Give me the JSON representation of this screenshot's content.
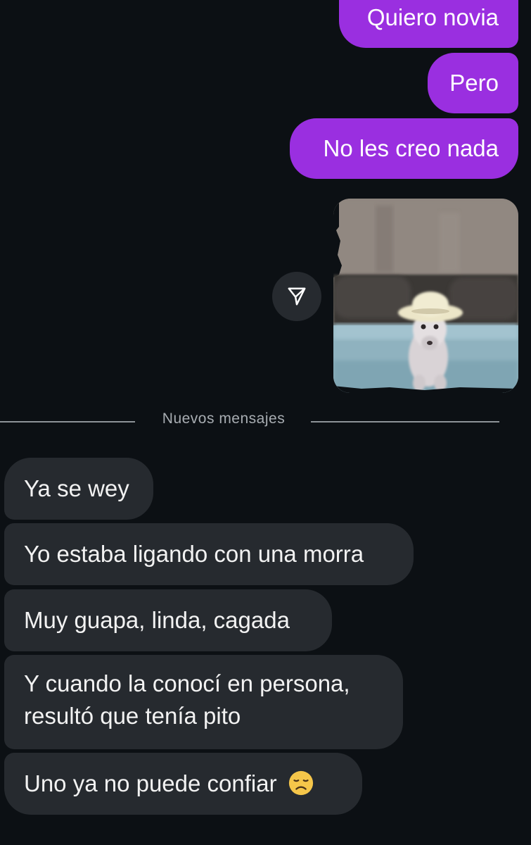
{
  "outgoing_messages": [
    {
      "text": "Quiero novia"
    },
    {
      "text": "Pero"
    },
    {
      "text": "No les creo nada"
    }
  ],
  "image_message": {
    "description_icon": "share-icon"
  },
  "divider": {
    "label": "Nuevos mensajes"
  },
  "incoming_messages": [
    {
      "text": "Ya se wey"
    },
    {
      "text": "Yo estaba ligando con una morra"
    },
    {
      "text": "Muy guapa, linda, cagada"
    },
    {
      "text": "Y cuando la conocí en persona, resultó que tenía pito"
    },
    {
      "text": "Uno ya no puede confiar",
      "emoji": "disappointed-face-icon"
    }
  ],
  "colors": {
    "background": "#0c1014",
    "outgoing_bubble": "#9a2fe0",
    "incoming_bubble": "#262a2f",
    "divider_text": "#a8adb2"
  }
}
